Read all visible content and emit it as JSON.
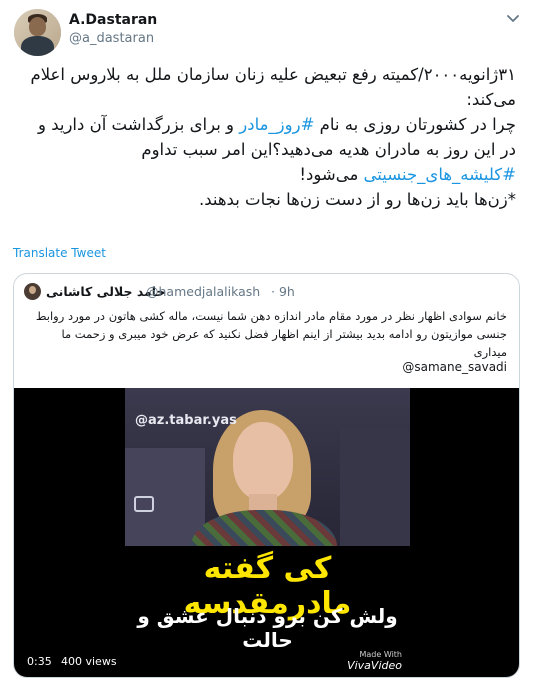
{
  "tweet": {
    "name": "A.Dastaran",
    "handle": "@a_dastaran",
    "text_lines": [
      [
        "۳۱ژانویه۲۰۰۰/کمیته رفع تبعیض علیه زنان سازمان ملل به بلاروس اعلام"
      ],
      [
        "می‌کند:"
      ],
      [
        "چرا در کشورتان روزی به نام ",
        {
          "link": "#روز_مادر"
        },
        " و برای بزرگداشت آن دارید و"
      ],
      [
        "در این روز به مادران هدیه می‌دهید؟این امر سبب تداوم"
      ],
      [
        {
          "link": "#کلیشه_های_جنسیتی"
        },
        " می‌شود!"
      ],
      [
        "*زن‌ها باید زن‌ها رو از دست زن‌ها نجات بدهند."
      ]
    ],
    "translate_label": "Translate Tweet"
  },
  "quoted": {
    "name": "حامد جلالی کاشانی",
    "handle": "@hamedjalalikash",
    "time": "· 9h",
    "text": "خانم سوادی اظهار نظر در مورد مقام مادر اندازه دهن شما نیست، ماله کشی هاتون در مورد روابط جنسی موازیتون رو ادامه بدید بیشتر از اینم اظهار فضل نکنید که عرض خود میبری و زحمت ما میداری",
    "mention": "@samane_savadi",
    "video": {
      "watermark": "@az.tabar.yas",
      "caption_line1": "کی گفته مادرمقدسه",
      "caption_line2": "ولش کن برو دنبال عشق و حالت",
      "made_with": "Made With",
      "brand": "VivaVideo",
      "duration": "0:35",
      "views": "400 views"
    }
  },
  "colors": {
    "link": "#1b95e0",
    "muted": "#657786",
    "border": "#ccd6dd",
    "caption_yellow": "#ffe600"
  }
}
